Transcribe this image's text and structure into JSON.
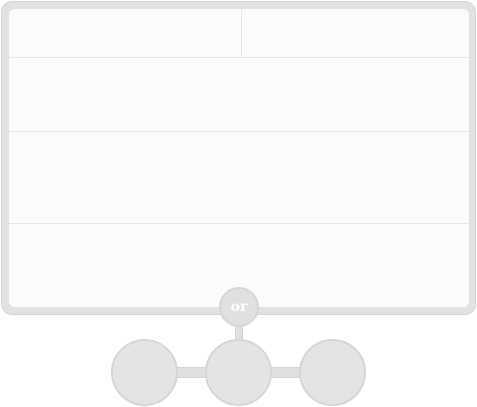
{
  "connector": {
    "label": "or"
  },
  "colors": {
    "frame": "#e2e2e2",
    "panel": "#fbfbfb",
    "divider": "#e6e6e6",
    "option_fill": "#e4e4e4",
    "option_border": "#d6d6d6",
    "connector_text": "#ffffff"
  },
  "options": [
    {
      "label": ""
    },
    {
      "label": ""
    },
    {
      "label": ""
    }
  ]
}
